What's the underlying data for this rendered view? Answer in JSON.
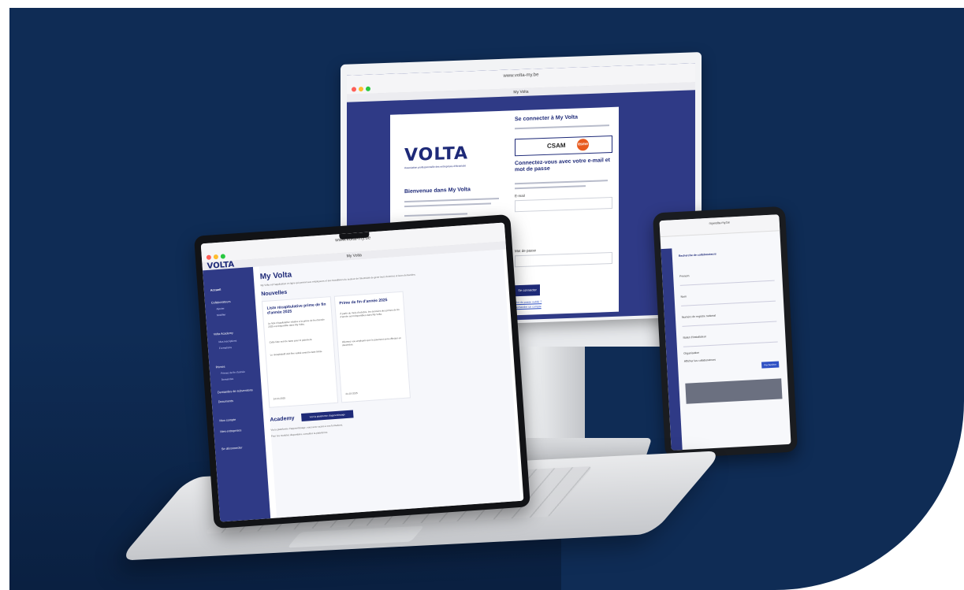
{
  "colors": {
    "background": "#0f2c55",
    "brand": "#1e2a78",
    "sidebar": "#2f3a86",
    "accent": "#2f51c4",
    "csam_badge": "#e85a1e"
  },
  "imac": {
    "browser_url": "www.volta-my.be",
    "tab_title": "My Volta",
    "left": {
      "logo": "VOLTA",
      "logo_sub": "Association professionnelle des entreprises d'électricité",
      "welcome": "Bienvenue dans My Volta"
    },
    "right": {
      "title": "Se connecter à My Volta",
      "csam_label": "CSAM",
      "csam_badge": "itsme",
      "heading": "Connectez-vous avec votre e-mail et mot de passe",
      "email_label": "E-mail",
      "password_label": "Mot de passe",
      "login_button": "Se connecter",
      "forgot_link": "Mot de passe oublié ?",
      "register_link": "Demander un compte"
    }
  },
  "tablet": {
    "browser_url": "mywolta.my.be",
    "section_title": "Recherche de collaborateurs",
    "fields": [
      "Prénom",
      "Nom",
      "Numéro de registre national",
      "Statut d'installateur",
      "Organisation"
    ],
    "filter_label": "Afficher les collaborateurs",
    "search_button": "Rechercher"
  },
  "laptop": {
    "browser_url": "www.volta-my.be",
    "tab_title": "My Volta",
    "logo": "VOLTA",
    "sidebar": {
      "items": [
        {
          "label": "Accueil"
        },
        {
          "label": "Collaborateurs"
        },
        {
          "label": "Volta Academy"
        },
        {
          "label": "Primes"
        },
        {
          "label": "Demandes de subventions"
        },
        {
          "label": "Documents"
        },
        {
          "label": "Mon compte"
        },
        {
          "label": "Mes entreprises"
        },
        {
          "label": "Se déconnecter"
        }
      ],
      "subitems": [
        "Ajouter",
        "Modifier",
        "Mes inscriptions",
        "Formations",
        "Primes de fin d'année",
        "Demandes"
      ]
    },
    "main": {
      "title": "My Volta",
      "description": "My Volta est l'application en ligne qui permet aux employeurs et aux travailleurs du secteur de l'électricité de gérer leurs données et leurs demandes.",
      "news_heading": "Nouvelles",
      "news": [
        {
          "title": "Liste récapitulative prime de fin d'année 2025",
          "paragraphs": [
            "La liste récapitulative relative à la prime de fin d'année 2025 est disponible dans My Volta.",
            "Cette liste sert de base pour le paiement.",
            "Le récapitulatif doit être validé avant la date limite."
          ],
          "date": "24-10-2025"
        },
        {
          "title": "Prime de fin d'année 2025",
          "paragraphs": [
            "À partir du mois d'octobre, les données des primes de fin d'année sont disponibles dans My Volta.",
            "Informez vos employés que le paiement sera effectué en décembre."
          ],
          "date": "24-10-2025"
        }
      ],
      "academy_heading": "Academy",
      "academy_button": "Voir la plateforme d'apprentissage",
      "academy_text_1": "Via la plateforme d'apprentissage, vous avez accès à vos formations.",
      "academy_text_2": "Pour les modules disponibles, consultez la plateforme."
    }
  }
}
